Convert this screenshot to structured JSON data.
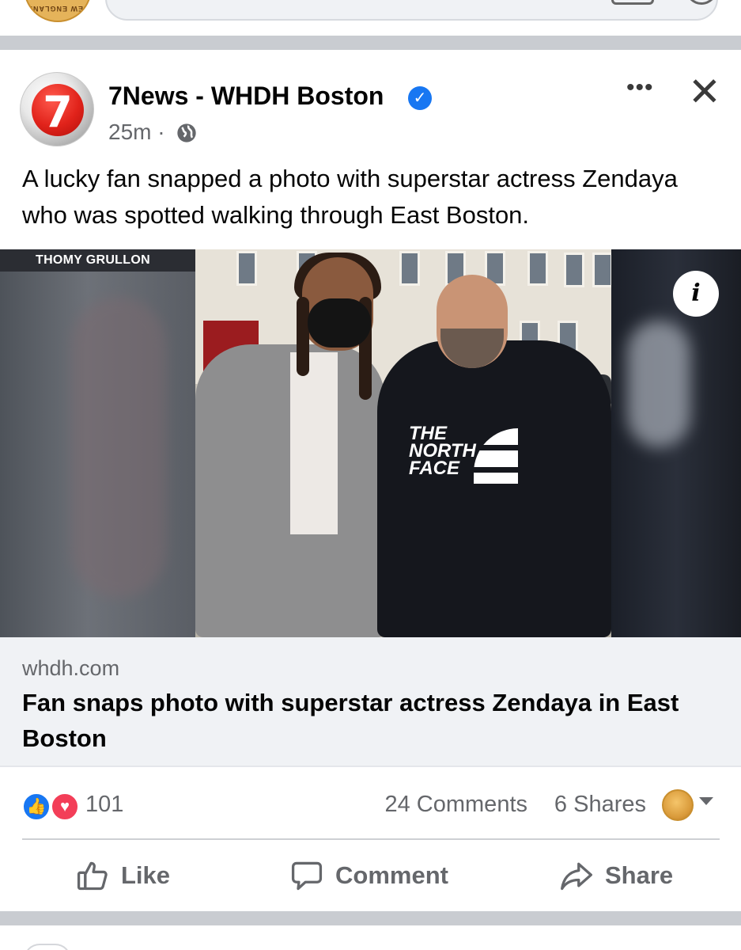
{
  "top_bar": {
    "avatar_text": "NEW ENGLAND"
  },
  "post": {
    "page_name": "7News - WHDH Boston",
    "avatar_label": "7",
    "verified": true,
    "time_ago": "25m",
    "separator": "·",
    "audience_icon": "globe-icon",
    "more_icon": "•••",
    "close_icon": "✕",
    "text": "A lucky fan snapped a photo with superstar actress Zendaya who was spotted walking through East Boston.",
    "image": {
      "credit": "THOMY GRULLON",
      "shirt_logo": "THE\nNORTH\nFACE",
      "info_icon": "i"
    },
    "link": {
      "domain": "whdh.com",
      "title": "Fan snaps photo with superstar actress Zendaya in East Boston"
    },
    "stats": {
      "reactions": [
        "like",
        "love"
      ],
      "reaction_count": "101",
      "comments": "24 Comments",
      "shares": "6 Shares"
    },
    "actions": {
      "like_label": "Like",
      "comment_label": "Comment",
      "share_label": "Share"
    }
  },
  "colors": {
    "accent": "#1877f2",
    "love": "#f33e58",
    "secondary_text": "#65676b",
    "divider": "#c9ccd1",
    "link_bg": "#f0f2f5"
  }
}
